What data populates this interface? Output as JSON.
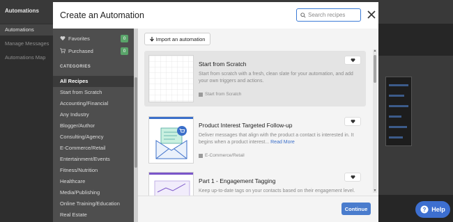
{
  "app": {
    "title": "Automations",
    "nav": [
      {
        "label": "Automations"
      },
      {
        "label": "Manage Messages"
      },
      {
        "label": "Automations Map"
      }
    ],
    "help_label": "Help"
  },
  "modal": {
    "title": "Create an Automation",
    "search_placeholder": "Search recipes",
    "favorites": {
      "label": "Favorites",
      "count": "0"
    },
    "purchased": {
      "label": "Purchased",
      "count": "0"
    },
    "categories_heading": "CATEGORIES",
    "categories": [
      {
        "label": "All Recipes"
      },
      {
        "label": "Start from Scratch"
      },
      {
        "label": "Accounting/Financial"
      },
      {
        "label": "Any Industry"
      },
      {
        "label": "Blogger/Author"
      },
      {
        "label": "Consulting/Agency"
      },
      {
        "label": "E-Commerce/Retail"
      },
      {
        "label": "Entertainment/Events"
      },
      {
        "label": "Fitness/Nutrition"
      },
      {
        "label": "Healthcare"
      },
      {
        "label": "Media/Publishing"
      },
      {
        "label": "Online Training/Education"
      },
      {
        "label": "Real Estate"
      }
    ],
    "import_label": "Import an automation",
    "recipes": [
      {
        "title": "Start from Scratch",
        "description": "Start from scratch with a fresh, clean slate for your automation, and add your own triggers and actions.",
        "tag": "Start from Scratch"
      },
      {
        "title": "Product Interest Targeted Follow-up",
        "description": "Deliver messages that align with the product a contact is interested in. It begins when a product interest...",
        "read_more": "Read More",
        "tag": "E-Commerce/Retail"
      },
      {
        "title": "Part 1 - Engagement Tagging",
        "description": "Keep up-to-date tags on your contacts based on their engagement level."
      }
    ],
    "continue_label": "Continue"
  },
  "colors": {
    "accent": "#4a7ccd",
    "badge": "#5aa46a",
    "help": "#3d6fd0",
    "sidebar": "#4e4e4e"
  }
}
